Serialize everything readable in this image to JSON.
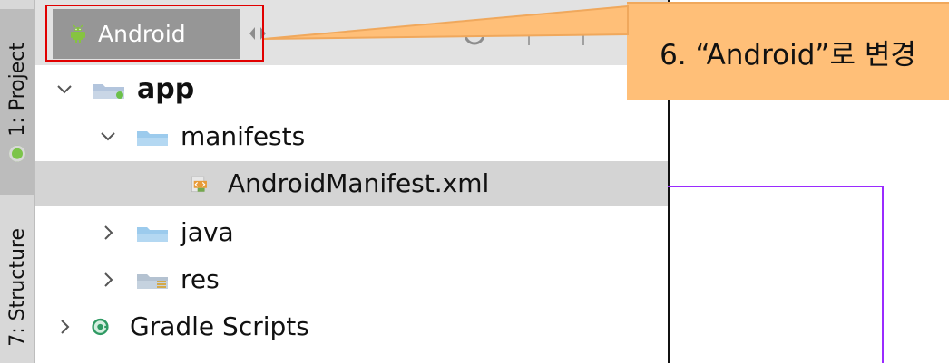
{
  "sidebar": {
    "tabs": [
      {
        "label": "1: Project",
        "icon": "android-project-icon"
      },
      {
        "label": "7: Structure",
        "icon": ""
      }
    ]
  },
  "toolbar": {
    "view_switcher": {
      "label": "Android",
      "icon": "android-icon"
    },
    "icons": [
      "settings-icon",
      "pin-icon",
      "collapse-icon"
    ]
  },
  "tree": {
    "items": [
      {
        "label": "app",
        "icon": "module-folder-icon",
        "expanded": true
      },
      {
        "label": "manifests",
        "icon": "folder-icon",
        "expanded": true
      },
      {
        "label": "AndroidManifest.xml",
        "icon": "xml-manifest-icon",
        "selected": true
      },
      {
        "label": "java",
        "icon": "folder-icon",
        "expanded": false
      },
      {
        "label": "res",
        "icon": "resource-folder-icon",
        "expanded": false
      },
      {
        "label": "Gradle Scripts",
        "icon": "gradle-icon",
        "expanded": false
      }
    ]
  },
  "annotation": {
    "callout_text": "6. “Android”로 변경"
  },
  "colors": {
    "callout_fill": "#ffbf78",
    "callout_border": "#f0a85c",
    "highlight_border": "#e10000",
    "purple_line": "#9a2bff",
    "selected_row": "#d4d4d4"
  }
}
